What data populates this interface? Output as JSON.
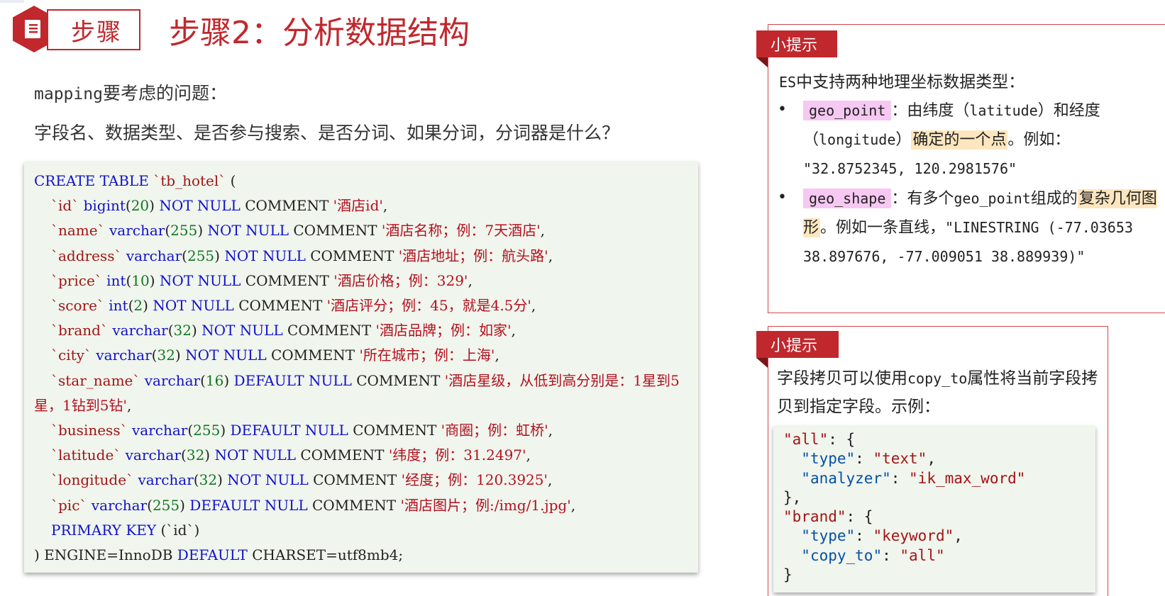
{
  "header": {
    "badge_label": "步骤",
    "title": "步骤2：分析数据结构",
    "icon": "document-icon"
  },
  "intro": {
    "line1_mono": "mapping",
    "line1_text": "要考虑的问题：",
    "line2": "字段名、数据类型、是否参与搜索、是否分词、如果分词，分词器是什么？"
  },
  "sql": {
    "l0_kw": "CREATE TABLE",
    "l0_table": "`tb_hotel`",
    "l0_paren": " (",
    "rows": [
      {
        "col": "`id`",
        "type": "bigint",
        "len": "20",
        "mod": "NOT NULL",
        "comment": "COMMENT",
        "str": "'酒店id'"
      },
      {
        "col": "`name`",
        "type": "varchar",
        "len": "255",
        "mod": "NOT NULL",
        "comment": "COMMENT",
        "str": "'酒店名称；例：7天酒店'"
      },
      {
        "col": "`address`",
        "type": "varchar",
        "len": "255",
        "mod": "NOT NULL",
        "comment": "COMMENT",
        "str": "'酒店地址；例：航头路'"
      },
      {
        "col": "`price`",
        "type": "int",
        "len": "10",
        "mod": "NOT NULL",
        "comment": "COMMENT",
        "str": "'酒店价格；例：329'"
      },
      {
        "col": "`score`",
        "type": "int",
        "len": "2",
        "mod": "NOT NULL",
        "comment": "COMMENT",
        "str": "'酒店评分；例：45，就是4.5分'"
      },
      {
        "col": "`brand`",
        "type": "varchar",
        "len": "32",
        "mod": "NOT NULL",
        "comment": "COMMENT",
        "str": "'酒店品牌；例：如家'"
      },
      {
        "col": "`city`",
        "type": "varchar",
        "len": "32",
        "mod": "NOT NULL",
        "comment": "COMMENT",
        "str": "'所在城市；例：上海'"
      },
      {
        "col": "`star_name`",
        "type": "varchar",
        "len": "16",
        "mod": "DEFAULT NULL",
        "comment": "COMMENT",
        "str": "'酒店星级，从低到高分别是：1星到5",
        "str_cont": "星，1钻到5钻'"
      },
      {
        "col": "`business`",
        "type": "varchar",
        "len": "255",
        "mod": "DEFAULT NULL",
        "comment": "COMMENT",
        "str": "'商圈；例：虹桥'"
      },
      {
        "col": "`latitude`",
        "type": "varchar",
        "len": "32",
        "mod": "NOT NULL",
        "comment": "COMMENT",
        "str": "'纬度；例：31.2497'"
      },
      {
        "col": "`longitude`",
        "type": "varchar",
        "len": "32",
        "mod": "NOT NULL",
        "comment": "COMMENT",
        "str": "'经度；例：120.3925'"
      },
      {
        "col": "`pic`",
        "type": "varchar",
        "len": "255",
        "mod": "DEFAULT NULL",
        "comment": "COMMENT",
        "str": "'酒店图片；例:/img/1.jpg'"
      }
    ],
    "pk_kw": "PRIMARY KEY",
    "pk_col": " (`id`)",
    "end_1": ") ENGINE=InnoDB ",
    "end_kw": "DEFAULT",
    "end_2": " CHARSET=utf8mb4;"
  },
  "tip1": {
    "tag": "小提示",
    "head_mono": "ES",
    "head_text": "中支持两种地理坐标数据类型：",
    "b1_code": "geo_point",
    "b1_t1": "：由纬度（",
    "b1_m1": "latitude",
    "b1_t2": "）和经度（",
    "b1_m2": "longitude",
    "b1_t3": "）",
    "b1_hl": "确定的一个点",
    "b1_t4": "。例如：",
    "b1_example": "\"32.8752345, 120.2981576\"",
    "b2_code": "geo_shape",
    "b2_t1": "：有多个",
    "b2_m1": "geo_point",
    "b2_t2": "组成的",
    "b2_hl": "复杂几何图形",
    "b2_t3": "。例如一条直线，",
    "b2_example": "\"LINESTRING (-77.03653 38.897676, -77.009051 38.889939)\"",
    "bullet": "•"
  },
  "tip2": {
    "tag": "小提示",
    "t1": "字段拷贝可以使用",
    "m1": "copy_to",
    "t2": "属性将当前字段拷贝到指定字段。示例：",
    "json": {
      "k_all": "\"all\"",
      "k_type": "\"type\"",
      "v_text": "\"text\"",
      "k_analyzer": "\"analyzer\"",
      "v_ik": "\"ik_max_word\"",
      "k_brand": "\"brand\"",
      "v_keyword": "\"keyword\"",
      "k_copy": "\"copy_to\"",
      "v_all": "\"all\""
    }
  },
  "colors": {
    "accent": "#c0282d",
    "code_bg": "#f0f5ed",
    "keyword": "#1111cc",
    "number": "#117722",
    "string": "#b3101f",
    "highlight_pink": "#f6c8f2",
    "highlight_peach": "#fde6bf"
  }
}
